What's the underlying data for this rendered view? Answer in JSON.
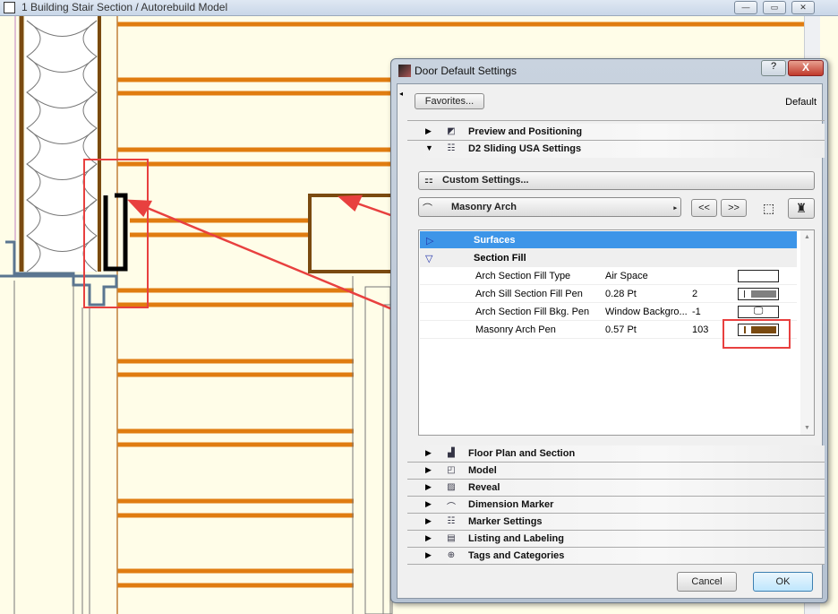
{
  "window": {
    "title": "1 Building Stair Section / Autorebuild Model",
    "controls": [
      "minimize",
      "restore",
      "close"
    ]
  },
  "annotation": {
    "question_mark": "?",
    "highlight_color": "#e8403f"
  },
  "colors": {
    "orange_line": "#e07c10",
    "masonry_pen": "#7a4a10",
    "selection": "#3d95e8"
  },
  "dialog": {
    "title": "Door Default Settings",
    "help": "?",
    "close": "X",
    "favorites": "Favorites...",
    "default_label": "Default",
    "sections_top": [
      {
        "label": "Preview and Positioning",
        "expanded": false,
        "icon": "preview-icon"
      },
      {
        "label": "D2 Sliding USA Settings",
        "expanded": true,
        "icon": "settings-list-icon"
      }
    ],
    "custom_settings": "Custom Settings...",
    "page_select": "Masonry Arch",
    "prev": "<<",
    "next": ">>",
    "tree": [
      {
        "label": "Surfaces",
        "type": "group",
        "expanded": false,
        "selected": true
      },
      {
        "label": "Section Fill",
        "type": "group",
        "expanded": true
      }
    ],
    "params": [
      {
        "name": "Arch Section Fill Type",
        "value": "Air Space",
        "num": "",
        "swatch": "empty"
      },
      {
        "name": "Arch Sill Section Fill Pen",
        "value": "0.28 Pt",
        "num": "2",
        "swatch": "#808080"
      },
      {
        "name": "Arch Section Fill Bkg. Pen",
        "value": "Window Backgro...",
        "num": "-1",
        "swatch": "monitor"
      },
      {
        "name": "Masonry Arch Pen",
        "value": "0.57 Pt",
        "num": "103",
        "swatch": "#7a4a10"
      }
    ],
    "sections_bottom": [
      {
        "label": "Floor Plan and Section",
        "icon": "floor-plan-icon"
      },
      {
        "label": "Model",
        "icon": "model-icon"
      },
      {
        "label": "Reveal",
        "icon": "reveal-icon"
      },
      {
        "label": "Dimension Marker",
        "icon": "dimension-icon"
      },
      {
        "label": "Marker Settings",
        "icon": "marker-icon"
      },
      {
        "label": "Listing and Labeling",
        "icon": "listing-icon"
      },
      {
        "label": "Tags and Categories",
        "icon": "tags-icon"
      }
    ],
    "cancel": "Cancel",
    "ok": "OK"
  }
}
